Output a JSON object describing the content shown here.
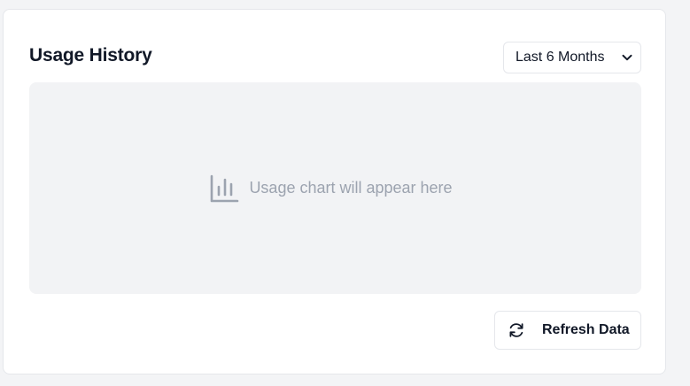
{
  "card": {
    "title": "Usage History",
    "range_select": {
      "selected": "Last 6 Months",
      "icon": "chevron-down-icon"
    },
    "chart_placeholder": {
      "icon": "bar-chart-icon",
      "text": "Usage chart will appear here"
    },
    "refresh_button": {
      "label": "Refresh Data",
      "icon": "refresh-icon"
    }
  },
  "colors": {
    "page_background": "#f3f4f6",
    "card_background": "#ffffff",
    "chart_background": "#f2f3f5",
    "muted_text": "#9ca3af",
    "primary_text": "#111827",
    "border": "#e5e7eb"
  }
}
